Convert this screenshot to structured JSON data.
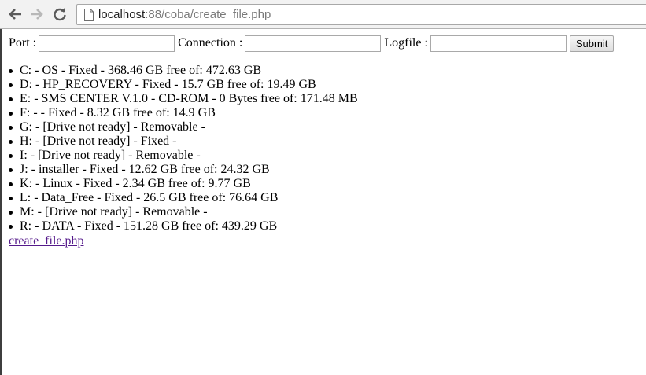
{
  "browser": {
    "url_host": "localhost",
    "url_path": ":88/coba/create_file.php"
  },
  "form": {
    "port_label": "Port :",
    "port_value": "",
    "connection_label": "Connection :",
    "connection_value": "",
    "logfile_label": "Logfile :",
    "logfile_value": "",
    "submit_label": "Submit"
  },
  "drives": [
    "C: - OS - Fixed - 368.46 GB free of: 472.63 GB",
    "D: - HP_RECOVERY - Fixed - 15.7 GB free of: 19.49 GB",
    "E: - SMS CENTER V.1.0 - CD-ROM - 0 Bytes free of: 171.48 MB",
    "F: - - Fixed - 8.32 GB free of: 14.9 GB",
    "G: - [Drive not ready] - Removable -",
    "H: - [Drive not ready] - Fixed -",
    "I: - [Drive not ready] - Removable -",
    "J: - installer - Fixed - 12.62 GB free of: 24.32 GB",
    "K: - Linux - Fixed - 2.34 GB free of: 9.77 GB",
    "L: - Data_Free - Fixed - 26.5 GB free of: 76.64 GB",
    "M: - [Drive not ready] - Removable -",
    "R: - DATA - Fixed - 151.28 GB free of: 439.29 GB"
  ],
  "link": {
    "text": "create_file.php"
  },
  "icons": {
    "back": "arrow-left-icon",
    "forward": "arrow-right-icon",
    "reload": "reload-icon",
    "page": "page-icon"
  },
  "colors": {
    "link_visited": "#551a8b",
    "toolbar_bg": "#f2f2f2"
  }
}
